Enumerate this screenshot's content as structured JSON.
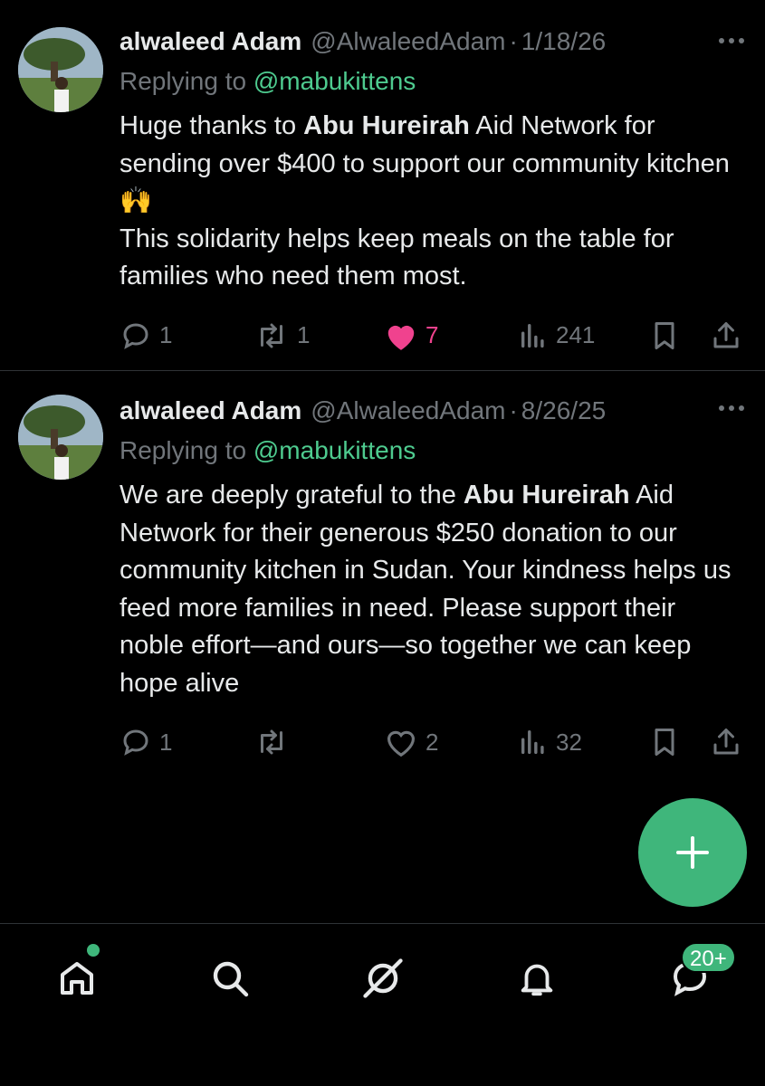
{
  "tweets": [
    {
      "author_name": "alwaleed Adam",
      "handle": "@AlwaleedAdam",
      "separator": "·",
      "date": "1/18/26",
      "replying_prefix": "Replying to ",
      "replying_to": "@mabukittens",
      "body_parts": [
        "Huge thanks to ",
        "Abu Hureirah",
        " Aid Network for sending over $400 to support our community kitchen 🙌",
        "This solidarity helps keep meals on the table for families who need them most."
      ],
      "replies": "1",
      "reposts": "1",
      "likes": "7",
      "liked": true,
      "views": "241"
    },
    {
      "author_name": "alwaleed Adam",
      "handle": "@AlwaleedAdam",
      "separator": "·",
      "date": "8/26/25",
      "replying_prefix": "Replying to ",
      "replying_to": "@mabukittens",
      "body_parts": [
        "We are deeply grateful to the ",
        "Abu Hureirah",
        " Aid Network for their generous $250 donation to our community kitchen in Sudan. Your kindness helps us feed more families in need. Please support their noble effort—and ours—so together we can keep hope alive"
      ],
      "replies": "1",
      "reposts": "",
      "likes": "2",
      "liked": false,
      "views": "32"
    }
  ],
  "compose": {
    "icon": "plus-icon"
  },
  "nav": {
    "items": [
      "home-icon",
      "search-icon",
      "grok-icon",
      "bell-icon",
      "messages-icon"
    ],
    "messages_badge": "20+"
  },
  "colors": {
    "accent": "#3fb67b",
    "mention": "#4ecb8f",
    "like": "#f0428e",
    "muted": "#71767b",
    "text": "#e7e9ea",
    "background": "#000000"
  }
}
